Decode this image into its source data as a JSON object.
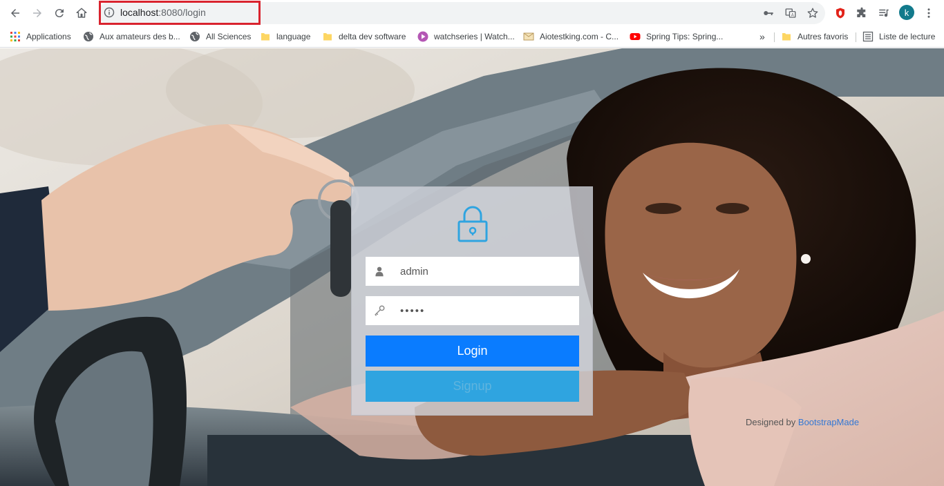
{
  "browser": {
    "url_host": "localhost",
    "url_rest": ":8080/login",
    "profile_initial": "k",
    "highlight_color": "#d9232e"
  },
  "bookmarks": {
    "items": [
      {
        "label": "Applications",
        "icon": "apps-grid-icon"
      },
      {
        "label": "Aux amateurs des b...",
        "icon": "globe-icon"
      },
      {
        "label": "All Sciences",
        "icon": "globe-icon"
      },
      {
        "label": "language",
        "icon": "folder-icon"
      },
      {
        "label": "delta dev software",
        "icon": "folder-icon"
      },
      {
        "label": "watchseries | Watch...",
        "icon": "play-icon"
      },
      {
        "label": "Aiotestking.com - C...",
        "icon": "mail-icon"
      },
      {
        "label": "Spring Tips: Spring...",
        "icon": "youtube-icon"
      }
    ],
    "overflow": "»",
    "other_bookmarks": "Autres favoris",
    "reading_list": "Liste de lecture"
  },
  "login": {
    "username_value": "admin",
    "password_value": "•••••",
    "login_label": "Login",
    "signup_label": "Signup",
    "accent": "#0a7cff",
    "secondary": "#2fa4e0",
    "lock_color": "#2fa4e0"
  },
  "footer": {
    "credit_prefix": "Designed by",
    "credit_link": "BootstrapMade"
  }
}
